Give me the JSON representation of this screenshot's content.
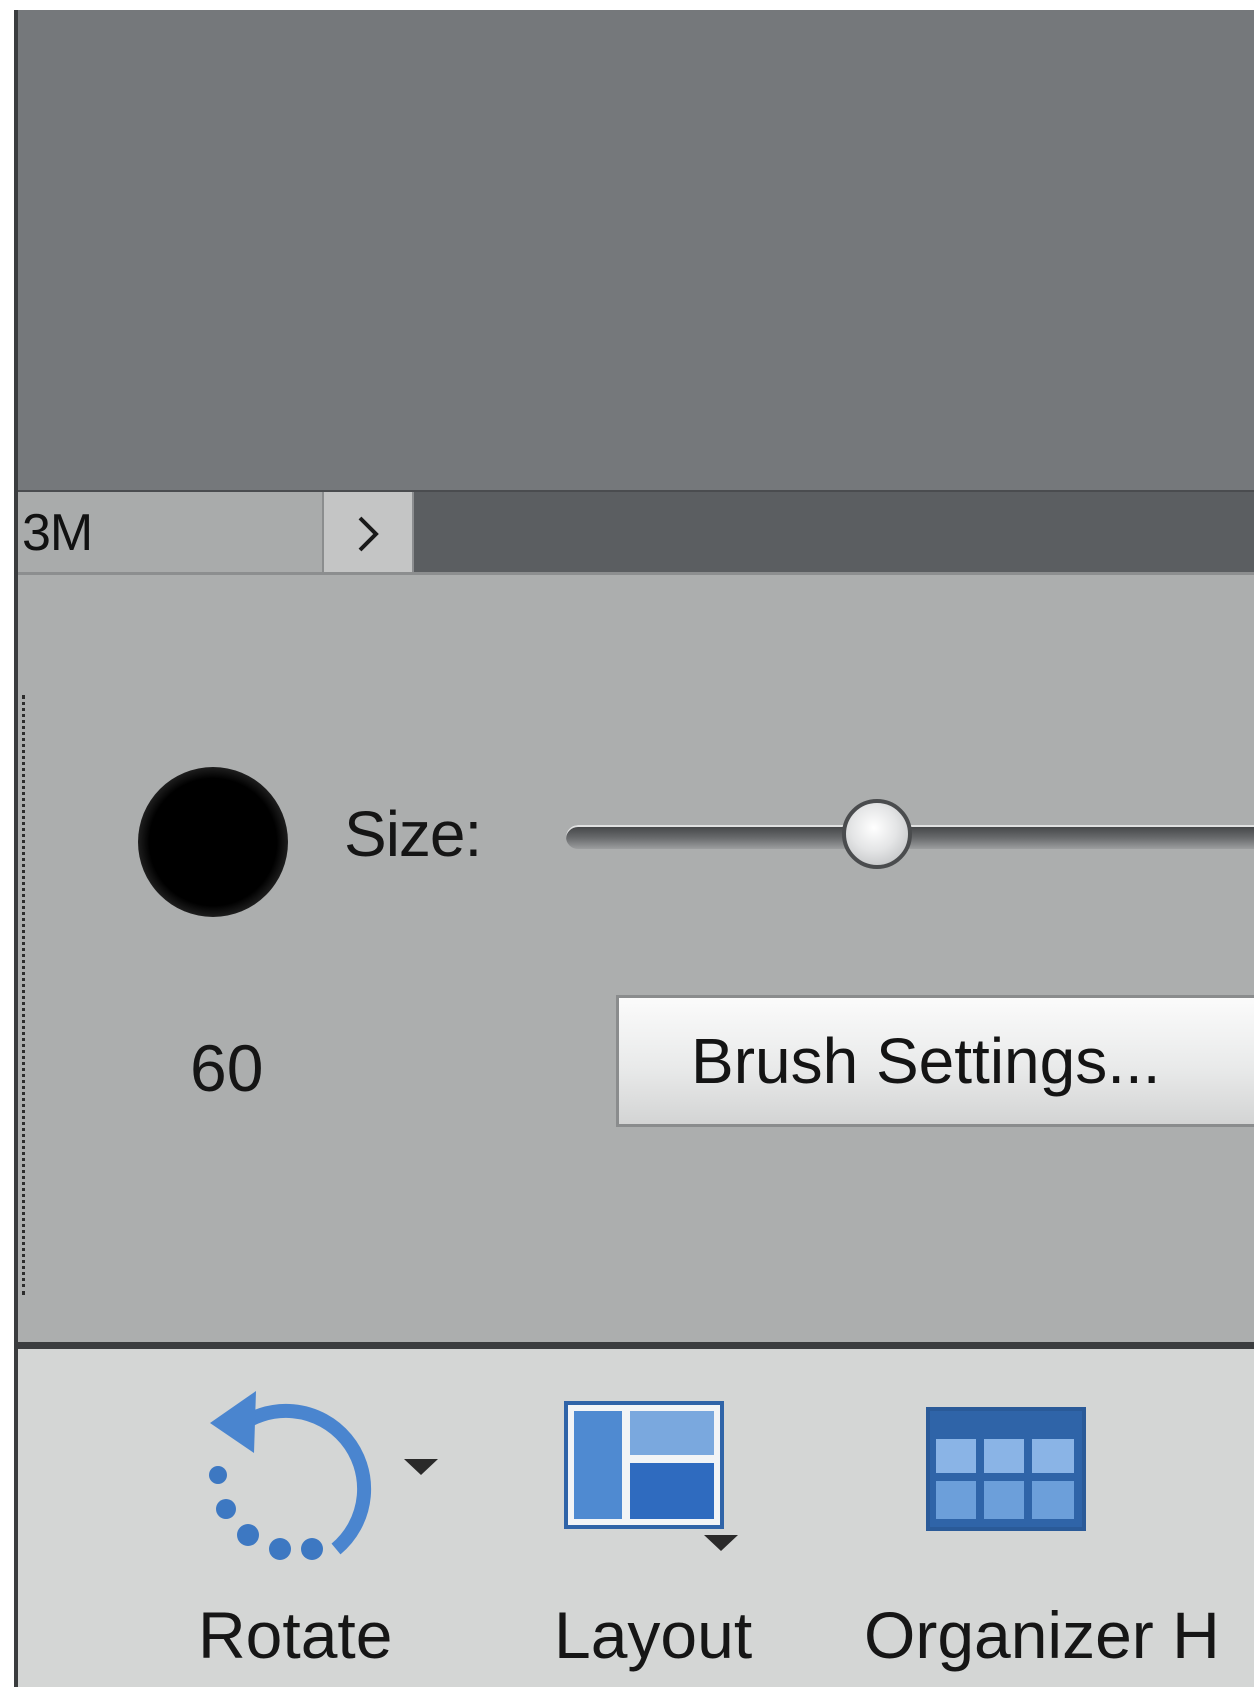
{
  "status_bar": {
    "doc_size": "3M",
    "expand_icon": "chevron-right-icon"
  },
  "tool_options": {
    "brush_size_label": "Size:",
    "brush_size_value": "60",
    "size_slider_fraction": 0.42,
    "brush_settings_label": "Brush Settings..."
  },
  "taskbar": {
    "items": [
      {
        "label": "Rotate",
        "icon": "rotate-icon"
      },
      {
        "label": "Layout",
        "icon": "layout-icon"
      },
      {
        "label": "Organizer H",
        "icon": "organizer-icon"
      }
    ]
  },
  "colors": {
    "icon_blue": "#3f79c4",
    "canvas_gray": "#75787b",
    "panel_gray": "#acaeae"
  }
}
